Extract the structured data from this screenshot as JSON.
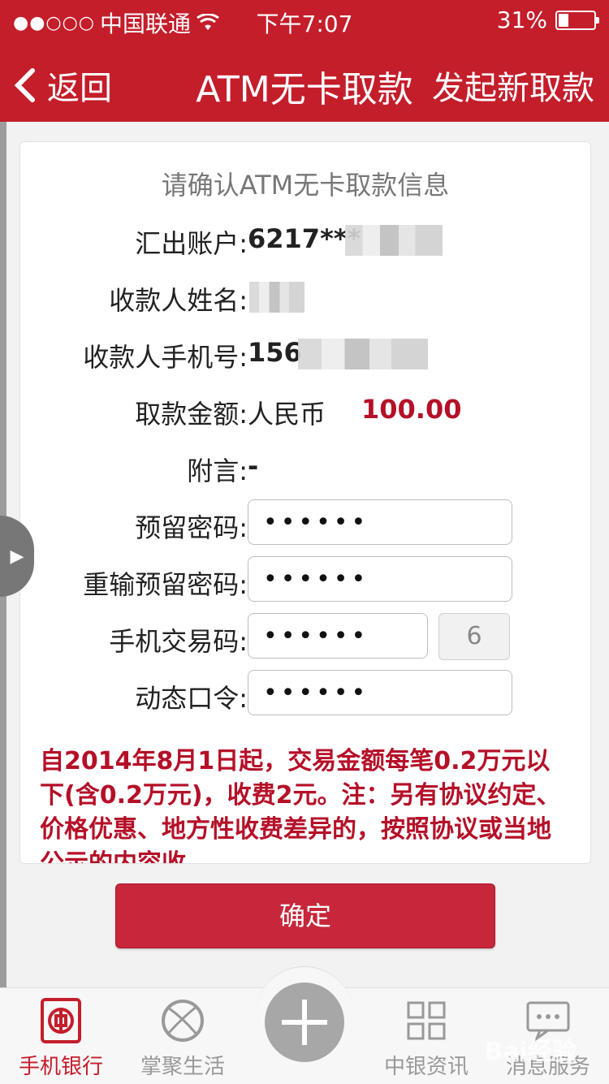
{
  "status_bar": {
    "carrier": "中国联通",
    "time": "下午7:07",
    "battery": "31%",
    "battery_level": 0.31
  },
  "nav": {
    "back": "返回",
    "title": "ATM无卡取款",
    "action": "发起新取款"
  },
  "card": {
    "heading": "请确认ATM无卡取款信息",
    "account_label": "汇出账户:",
    "account_value": "6217***",
    "payee_name_label": "收款人姓名:",
    "payee_phone_label": "收款人手机号:",
    "payee_phone_value": "156",
    "amount_label": "取款金额:",
    "currency": "人民币",
    "amount": "100.00",
    "memo_label": "附言:",
    "memo_value": "-",
    "reserved_pwd_label": "预留密码:",
    "reserved_pwd_value": "••••••",
    "reenter_pwd_label": "重输预留密码:",
    "reenter_pwd_value": "••••••",
    "sms_code_label": "手机交易码:",
    "sms_code_value": "••••••",
    "sms_countdown": "6",
    "otp_label": "动态口令:",
    "otp_value": "••••••",
    "notice": "自2014年8月1日起，交易金额每笔0.2万元以下(含0.2万元)，收费2元。注：另有协议约定、价格优惠、地方性收费差异的，按照协议或当地公示的内容收"
  },
  "confirm_button": "确定",
  "tabs": [
    {
      "label": "手机银行",
      "icon": "boc-logo-icon"
    },
    {
      "label": "掌聚生活",
      "icon": "basketball-icon"
    },
    {
      "label": "中银资讯",
      "icon": "grid-icon"
    },
    {
      "label": "消息服务",
      "icon": "message-icon"
    }
  ],
  "watermark": "Bai经验",
  "colors": {
    "brand_red": "#c41e2b",
    "amount_red": "#b51028"
  }
}
